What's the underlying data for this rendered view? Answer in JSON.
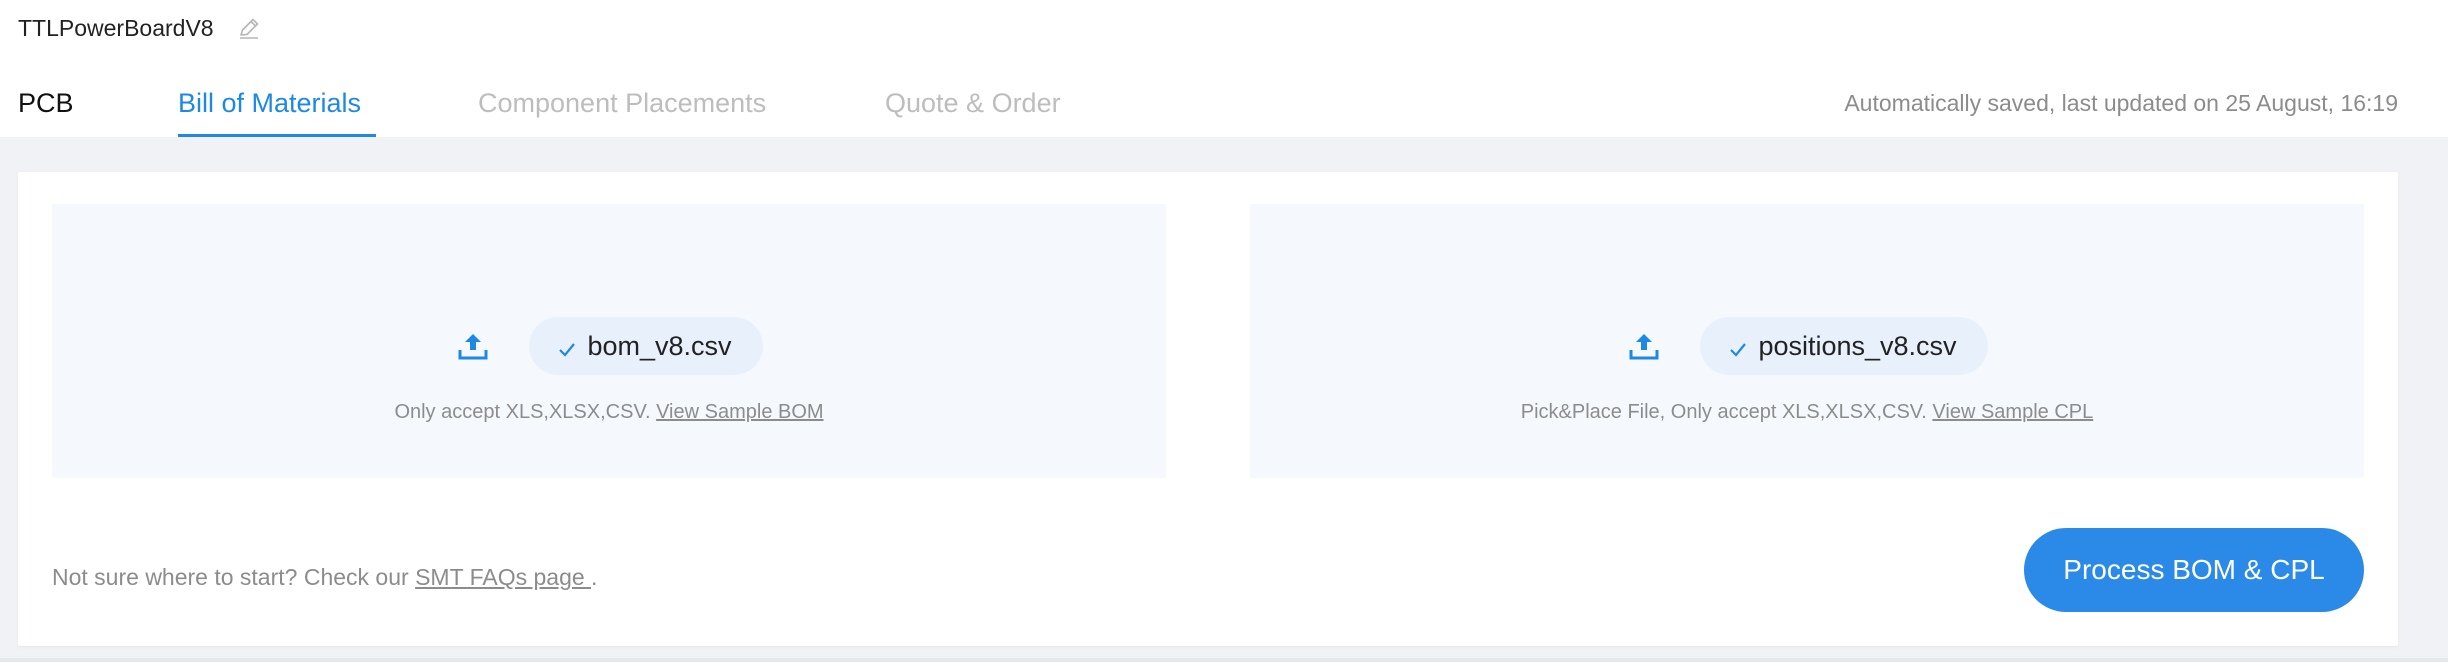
{
  "project": {
    "name": "TTLPowerBoardV8",
    "edit_icon": "pencil-icon"
  },
  "tabs": [
    {
      "label": "PCB",
      "state": "default"
    },
    {
      "label": "Bill of Materials",
      "state": "active"
    },
    {
      "label": "Component Placements",
      "state": "disabled"
    },
    {
      "label": "Quote & Order",
      "state": "disabled"
    }
  ],
  "save_status": "Automatically saved, last updated on 25 August, 16:19",
  "uploads": {
    "bom": {
      "file_name": "bom_v8.csv",
      "hint_text": "Only accept XLS,XLSX,CSV.",
      "sample_link": "View Sample BOM"
    },
    "cpl": {
      "file_name": "positions_v8.csv",
      "hint_text": "Pick&Place File, Only accept XLS,XLSX,CSV.",
      "sample_link": "View Sample CPL"
    }
  },
  "footer": {
    "prefix": "Not sure where to start? Check our",
    "link": "SMT FAQs page ",
    "suffix": "."
  },
  "process_button": "Process BOM & CPL",
  "colors": {
    "accent": "#1e88e5",
    "button": "#2b8ae8",
    "dropzone_bg": "#f5f9fe",
    "pill_bg": "#e8f1fb",
    "muted_text": "#8c8c8c",
    "page_bg": "#f0f2f5"
  }
}
